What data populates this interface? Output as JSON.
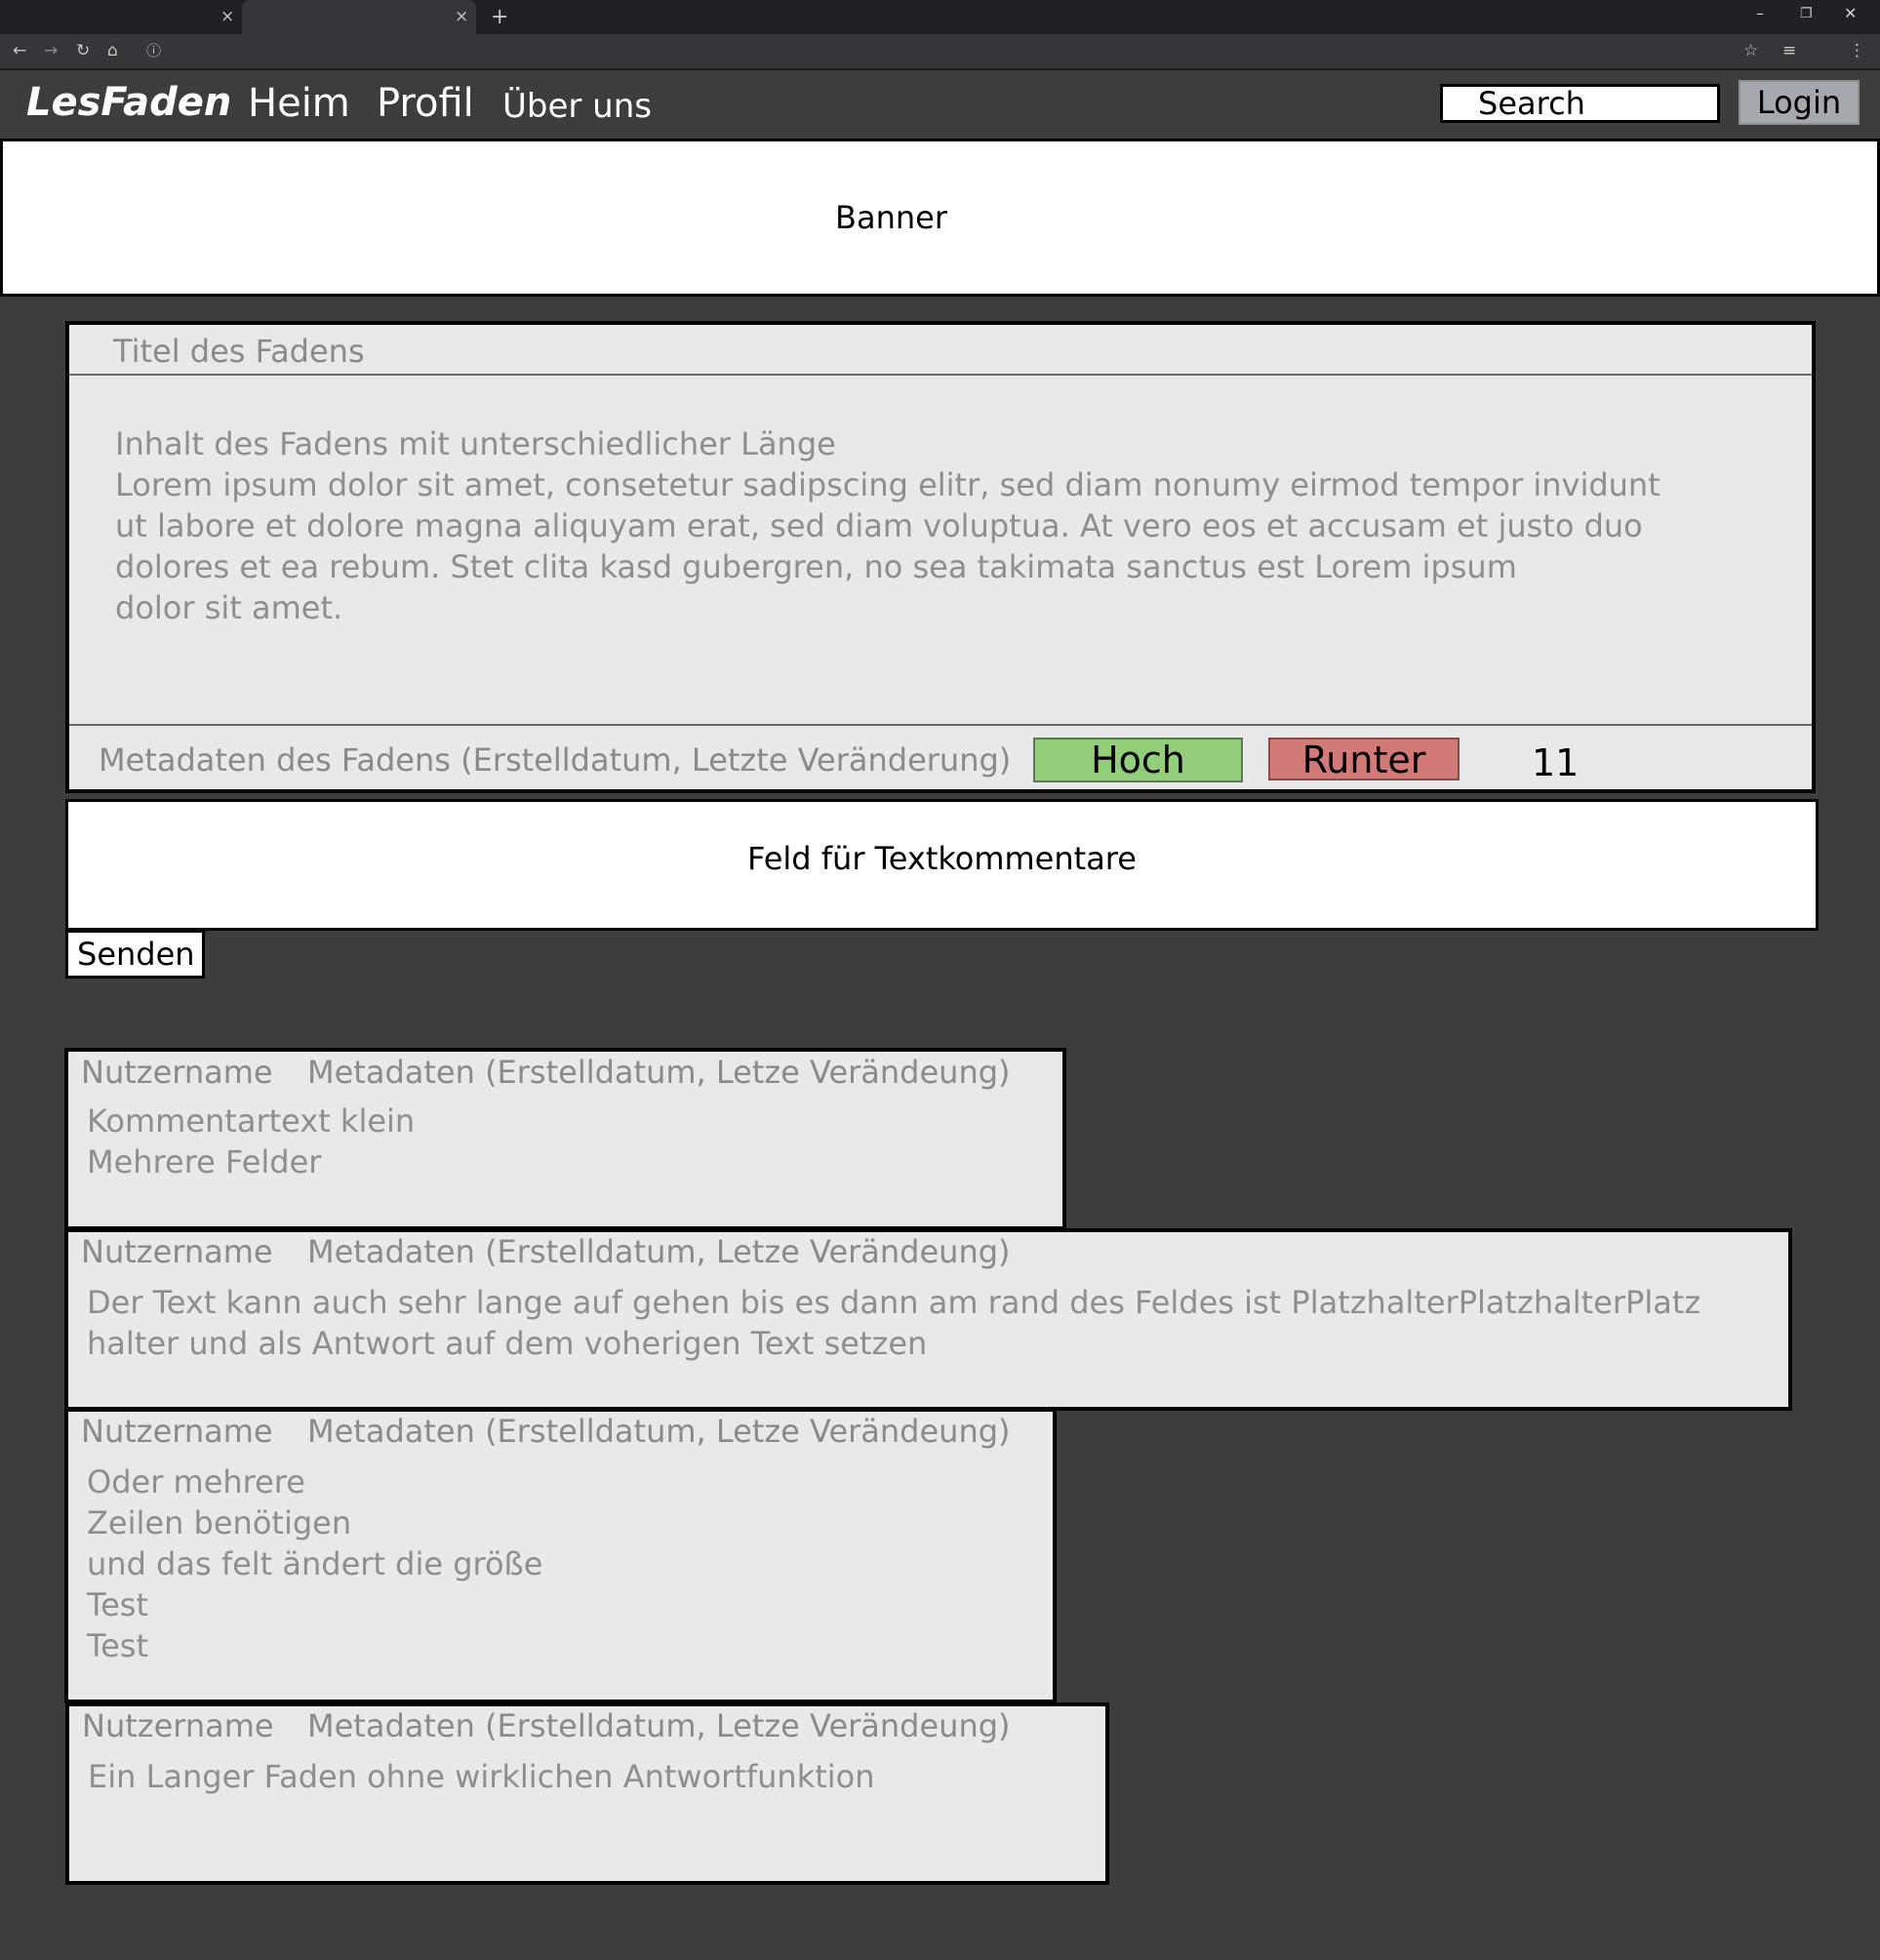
{
  "browser": {
    "tabs": [
      {
        "close": "×"
      },
      {
        "close": "×"
      }
    ],
    "new_tab": "+",
    "window_controls": {
      "minimize": "–",
      "restore": "❐",
      "close": "✕"
    },
    "toolbar_icons": [
      "back-icon",
      "forward-icon",
      "reload-icon",
      "home-icon",
      "info-icon",
      "star-icon",
      "playlist-icon",
      "menu-icon"
    ]
  },
  "nav": {
    "logo": "LesFaden",
    "links": [
      "Heim",
      "Profil",
      "Über uns"
    ],
    "search_placeholder": "Search",
    "login_label": "Login"
  },
  "banner": {
    "text": "Banner"
  },
  "thread": {
    "title": "Titel des Fadens",
    "body": "Inhalt des Fadens mit unterschiedlicher Länge\nLorem ipsum dolor sit amet, consetetur sadipscing elitr, sed diam nonumy eirmod tempor invidunt\nut labore et dolore magna aliquyam erat, sed diam voluptua. At vero eos et accusam et justo duo\ndolores et ea rebum. Stet clita kasd gubergren, no sea takimata sanctus est Lorem ipsum\ndolor sit amet.",
    "meta": "Metadaten des Fadens (Erstelldatum, Letzte Veränderung)",
    "vote_up_label": "Hoch",
    "vote_down_label": "Runter",
    "vote_count": "11"
  },
  "comment_form": {
    "field_text": "Feld für Textkommentare",
    "send_label": "Senden"
  },
  "comments": [
    {
      "user": "Nutzername",
      "meta": "Metadaten (Erstelldatum, Letze Verändeung)",
      "text": "Kommentartext klein\nMehrere Felder"
    },
    {
      "user": "Nutzername",
      "meta": "Metadaten (Erstelldatum, Letze Verändeung)",
      "text": "Der Text kann auch sehr lange auf gehen bis es dann am rand des Feldes ist PlatzhalterPlatzhalterPlatz\nhalter und als Antwort auf dem voherigen Text setzen"
    },
    {
      "user": "Nutzername",
      "meta": "Metadaten (Erstelldatum, Letze Verändeung)",
      "text": "Oder mehrere\nZeilen benötigen\nund das felt ändert die größe\nTest\nTest"
    },
    {
      "user": "Nutzername",
      "meta": "Metadaten (Erstelldatum, Letze Verändeung)",
      "text": "Ein Langer Faden ohne wirklichen Antwortfunktion"
    }
  ],
  "colors": {
    "page_background": "#3d3d3c",
    "card_background": "#e8e9e8",
    "vote_up": "#93cf7a",
    "vote_down": "#d27a78",
    "login_button": "#a5a8ac"
  }
}
